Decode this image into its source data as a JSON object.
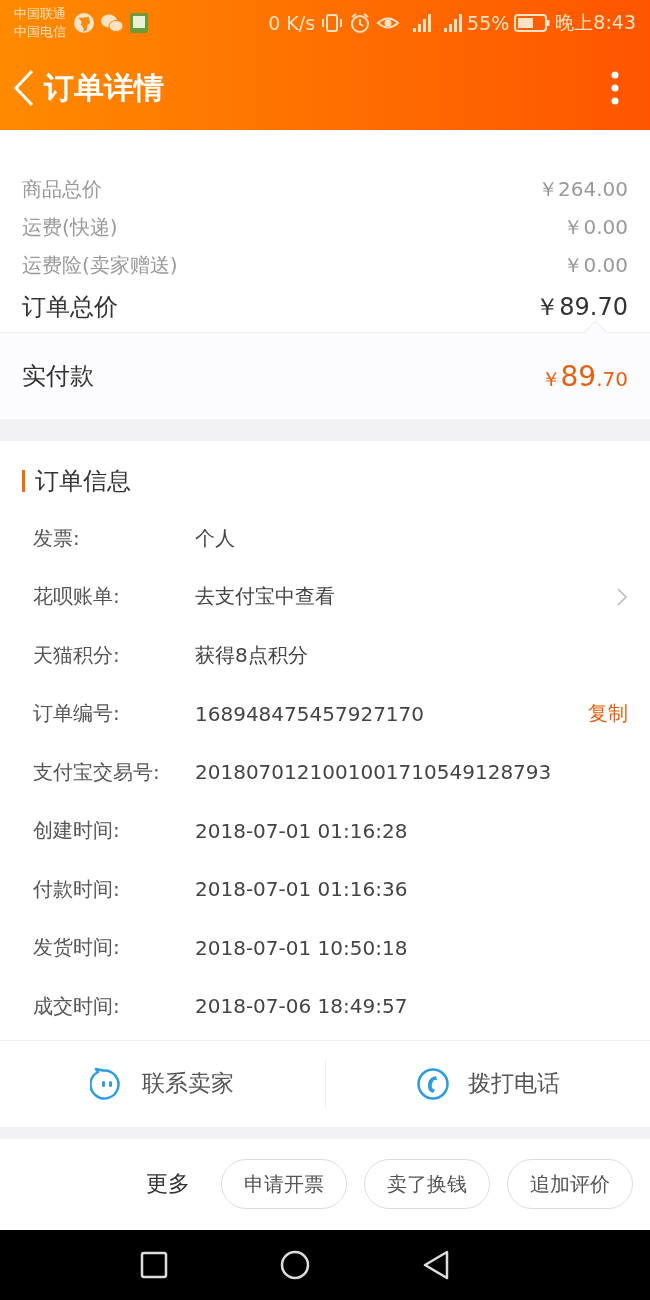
{
  "status_bar": {
    "carriers": [
      "中国联通",
      "中国电信"
    ],
    "speed": "0 K/s",
    "battery": "55%",
    "time": "晚上8:43"
  },
  "header": {
    "title": "订单详情"
  },
  "price_rows": [
    {
      "label": "商品总价",
      "value": "￥264.00",
      "kind": "minor"
    },
    {
      "label": "运费(快递)",
      "value": "￥0.00",
      "kind": "minor"
    },
    {
      "label": "运费险(卖家赠送)",
      "value": "￥0.00",
      "kind": "minor"
    },
    {
      "label": "订单总价",
      "value": "￥89.70",
      "kind": "total"
    }
  ],
  "paid": {
    "label": "实付款",
    "currency": "￥",
    "integer": "89",
    "decimal": ".70"
  },
  "order_info": {
    "title": "订单信息",
    "rows": [
      {
        "label": "发票:",
        "value": "个人",
        "kind": "plain"
      },
      {
        "label": "花呗账单:",
        "value": "去支付宝中查看",
        "kind": "link"
      },
      {
        "label": "天猫积分:",
        "value": "获得8点积分",
        "kind": "plain"
      },
      {
        "label": "订单编号:",
        "value": "168948475457927170",
        "kind": "copy",
        "action": "复制"
      },
      {
        "label": "支付宝交易号:",
        "value": "2018070121001001710549128793",
        "kind": "plain"
      },
      {
        "label": "创建时间:",
        "value": "2018-07-01 01:16:28",
        "kind": "plain"
      },
      {
        "label": "付款时间:",
        "value": "2018-07-01 01:16:36",
        "kind": "plain"
      },
      {
        "label": "发货时间:",
        "value": "2018-07-01 10:50:18",
        "kind": "plain"
      },
      {
        "label": "成交时间:",
        "value": "2018-07-06 18:49:57",
        "kind": "plain"
      }
    ]
  },
  "contact": [
    {
      "label": "联系卖家",
      "kind": "chat"
    },
    {
      "label": "拨打电话",
      "kind": "phone"
    }
  ],
  "actions": {
    "more": "更多",
    "buttons": [
      "申请开票",
      "卖了换钱",
      "追加评价"
    ]
  }
}
